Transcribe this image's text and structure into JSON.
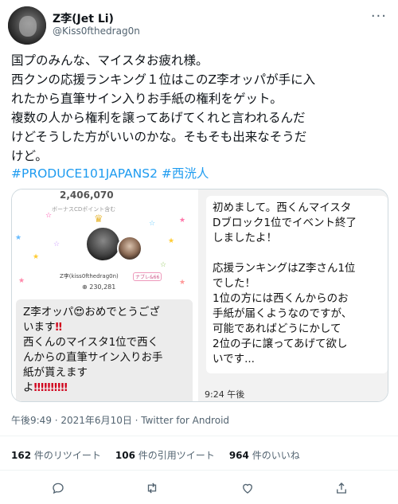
{
  "user": {
    "display_name": "Z李(Jet Li)",
    "handle": "@Kiss0fthedrag0n"
  },
  "tweet": {
    "text": "国プのみんな、マイスタお疲れ様。\n西クンの応援ランキング１位はこのZ李オッパが手に入\nれたから直筆サイン入りお手紙の権利をゲット。\n複数の人から権利を譲ってあげてくれと言われるんだ\nけどそうした方がいいのかな。そもそも出来なそうだ\nけど。",
    "hashtag1": "#PRODUCE101JAPANS2",
    "hashtag2": "#西洸人"
  },
  "media": {
    "left_top_partial": "2,406,070",
    "left_top_sub": "ボーナスCDポイント含む",
    "profile_name": "Z李(kiss0fthedrag0n)",
    "profile_badge": "ナブレ&66",
    "points": "230,281",
    "left_message_part1": "Z李オッパ",
    "left_message_part2": "おめでとうござ\nいます",
    "left_message_part3": "\n西くんのマイスタ1位で西く\nんからの直筆サイン入りお手\n紙が貰えます\nよ",
    "emoji_heart_eyes": "😍",
    "double_exclaim": "‼",
    "repeat_exclaim": "‼‼‼‼‼",
    "right_message": "初めまして。西くんマイスタ\nDブロック1位でイベント終了\nしましたよ！\n\n応援ランキングはZ李さん1位\nでした！\n1位の方には西くんからのお\n手紙が届くようなのですが、\n可能であればどうにかして\n2位の子に譲ってあげて欲し\nいです...",
    "time": "9:24 午後"
  },
  "meta": {
    "datetime": "午後9:49 · 2021年6月10日 · Twitter for Android"
  },
  "stats": {
    "retweets_count": "162",
    "retweets_label": "件のリツイート",
    "quotes_count": "106",
    "quotes_label": "件の引用ツイート",
    "likes_count": "964",
    "likes_label": "件のいいね"
  },
  "colors": {
    "accent": "#1d9bf0",
    "muted": "#536471",
    "divider": "#eff3f4"
  },
  "icons": [
    "reply-icon",
    "retweet-icon",
    "like-icon",
    "share-icon",
    "more-icon"
  ]
}
